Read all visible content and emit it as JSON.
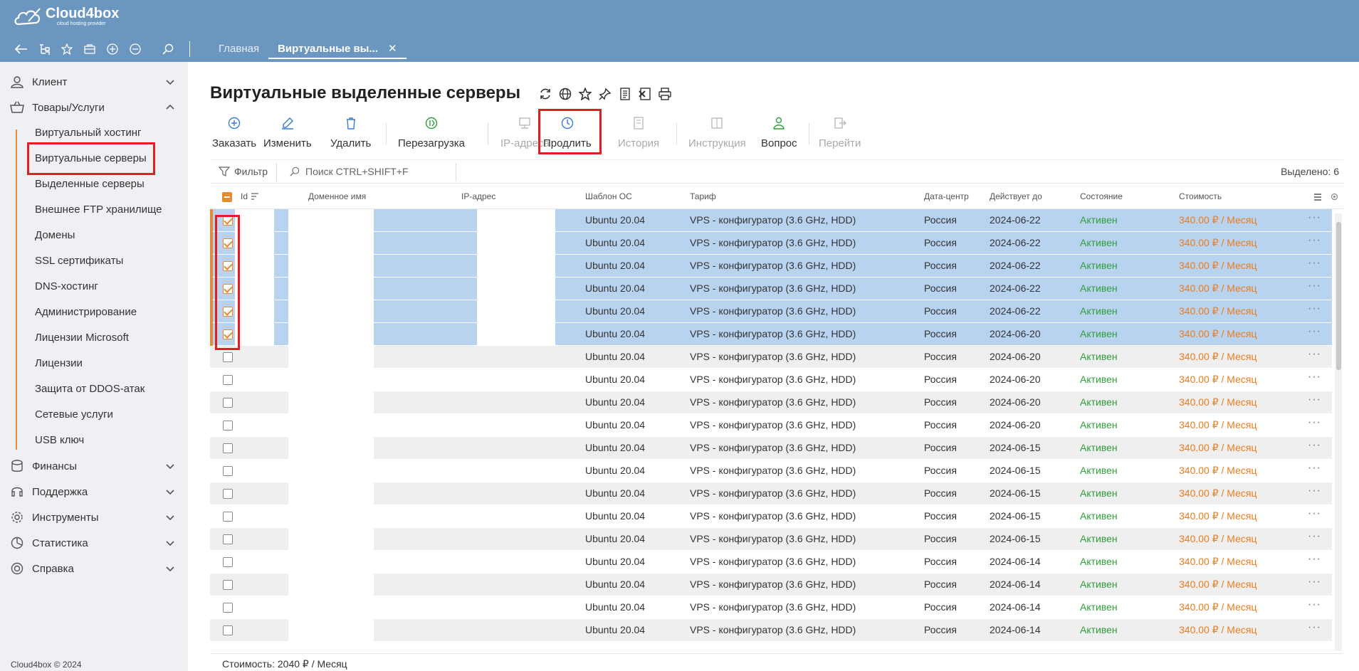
{
  "app": {
    "logo_text": "Cloud4box",
    "logo_sub": "cloud hosting provider",
    "copyright": "Cloud4box © 2024"
  },
  "tabs": [
    {
      "label": "Главная"
    },
    {
      "label": "Виртуальные вы..."
    }
  ],
  "sidebar": {
    "sections": [
      {
        "label": "Клиент"
      },
      {
        "label": "Товары/Услуги"
      },
      {
        "label": "Финансы"
      },
      {
        "label": "Поддержка"
      },
      {
        "label": "Инструменты"
      },
      {
        "label": "Статистика"
      },
      {
        "label": "Справка"
      }
    ],
    "sub_items": [
      {
        "label": "Виртуальный хостинг"
      },
      {
        "label": "Виртуальные серверы"
      },
      {
        "label": "Выделенные серверы"
      },
      {
        "label": "Внешнее FTP хранилище"
      },
      {
        "label": "Домены"
      },
      {
        "label": "SSL сертификаты"
      },
      {
        "label": "DNS-хостинг"
      },
      {
        "label": "Администрирование"
      },
      {
        "label": "Лицензии Microsoft"
      },
      {
        "label": "Лицензии"
      },
      {
        "label": "Защита от DDOS-атак"
      },
      {
        "label": "Сетевые услуги"
      },
      {
        "label": "USB ключ"
      }
    ]
  },
  "page": {
    "title": "Виртуальные выделенные серверы"
  },
  "actions": [
    {
      "label": "Заказать",
      "icon": "plus-circle-icon",
      "enabled": true
    },
    {
      "label": "Изменить",
      "icon": "edit-icon",
      "enabled": true
    },
    {
      "label": "Удалить",
      "icon": "trash-icon",
      "enabled": true
    },
    {
      "label": "Перезагрузка",
      "icon": "reboot-icon",
      "enabled": true
    },
    {
      "label": "IP-адреса",
      "icon": "ip-icon",
      "enabled": false
    },
    {
      "label": "Продлить",
      "icon": "clock-icon",
      "enabled": true
    },
    {
      "label": "История",
      "icon": "history-icon",
      "enabled": false
    },
    {
      "label": "Инструкция",
      "icon": "instruction-icon",
      "enabled": false
    },
    {
      "label": "Вопрос",
      "icon": "question-user-icon",
      "enabled": true
    },
    {
      "label": "Перейти",
      "icon": "goto-icon",
      "enabled": false
    }
  ],
  "filter": {
    "filter_label": "Фильтр",
    "search_placeholder": "Поиск CTRL+SHIFT+F",
    "selected_label": "Выделено: 6"
  },
  "table": {
    "headers": {
      "id": "Id",
      "domain": "Доменное имя",
      "ip": "IP-адрес",
      "os": "Шаблон ОС",
      "tariff": "Тариф",
      "dc": "Дата-центр",
      "valid_until": "Действует до",
      "state": "Состояние",
      "cost": "Стоимость"
    },
    "rows": [
      {
        "checked": true,
        "os": "Ubuntu 20.04",
        "tariff": "VPS - конфигуратор (3.6 GHz, HDD)",
        "dc": "Россия",
        "until": "2024-06-22",
        "state": "Активен",
        "cost": "340.00 ₽ / Месяц"
      },
      {
        "checked": true,
        "os": "Ubuntu 20.04",
        "tariff": "VPS - конфигуратор (3.6 GHz, HDD)",
        "dc": "Россия",
        "until": "2024-06-22",
        "state": "Активен",
        "cost": "340.00 ₽ / Месяц"
      },
      {
        "checked": true,
        "os": "Ubuntu 20.04",
        "tariff": "VPS - конфигуратор (3.6 GHz, HDD)",
        "dc": "Россия",
        "until": "2024-06-22",
        "state": "Активен",
        "cost": "340.00 ₽ / Месяц"
      },
      {
        "checked": true,
        "os": "Ubuntu 20.04",
        "tariff": "VPS - конфигуратор (3.6 GHz, HDD)",
        "dc": "Россия",
        "until": "2024-06-22",
        "state": "Активен",
        "cost": "340.00 ₽ / Месяц"
      },
      {
        "checked": true,
        "os": "Ubuntu 20.04",
        "tariff": "VPS - конфигуратор (3.6 GHz, HDD)",
        "dc": "Россия",
        "until": "2024-06-22",
        "state": "Активен",
        "cost": "340.00 ₽ / Месяц"
      },
      {
        "checked": true,
        "os": "Ubuntu 20.04",
        "tariff": "VPS - конфигуратор (3.6 GHz, HDD)",
        "dc": "Россия",
        "until": "2024-06-20",
        "state": "Активен",
        "cost": "340.00 ₽ / Месяц"
      },
      {
        "checked": false,
        "os": "Ubuntu 20.04",
        "tariff": "VPS - конфигуратор (3.6 GHz, HDD)",
        "dc": "Россия",
        "until": "2024-06-20",
        "state": "Активен",
        "cost": "340.00 ₽ / Месяц"
      },
      {
        "checked": false,
        "os": "Ubuntu 20.04",
        "tariff": "VPS - конфигуратор (3.6 GHz, HDD)",
        "dc": "Россия",
        "until": "2024-06-20",
        "state": "Активен",
        "cost": "340.00 ₽ / Месяц"
      },
      {
        "checked": false,
        "os": "Ubuntu 20.04",
        "tariff": "VPS - конфигуратор (3.6 GHz, HDD)",
        "dc": "Россия",
        "until": "2024-06-20",
        "state": "Активен",
        "cost": "340.00 ₽ / Месяц"
      },
      {
        "checked": false,
        "os": "Ubuntu 20.04",
        "tariff": "VPS - конфигуратор (3.6 GHz, HDD)",
        "dc": "Россия",
        "until": "2024-06-20",
        "state": "Активен",
        "cost": "340.00 ₽ / Месяц"
      },
      {
        "checked": false,
        "os": "Ubuntu 20.04",
        "tariff": "VPS - конфигуратор (3.6 GHz, HDD)",
        "dc": "Россия",
        "until": "2024-06-15",
        "state": "Активен",
        "cost": "340.00 ₽ / Месяц"
      },
      {
        "checked": false,
        "os": "Ubuntu 20.04",
        "tariff": "VPS - конфигуратор (3.6 GHz, HDD)",
        "dc": "Россия",
        "until": "2024-06-15",
        "state": "Активен",
        "cost": "340.00 ₽ / Месяц"
      },
      {
        "checked": false,
        "os": "Ubuntu 20.04",
        "tariff": "VPS - конфигуратор (3.6 GHz, HDD)",
        "dc": "Россия",
        "until": "2024-06-15",
        "state": "Активен",
        "cost": "340.00 ₽ / Месяц"
      },
      {
        "checked": false,
        "os": "Ubuntu 20.04",
        "tariff": "VPS - конфигуратор (3.6 GHz, HDD)",
        "dc": "Россия",
        "until": "2024-06-15",
        "state": "Активен",
        "cost": "340.00 ₽ / Месяц"
      },
      {
        "checked": false,
        "os": "Ubuntu 20.04",
        "tariff": "VPS - конфигуратор (3.6 GHz, HDD)",
        "dc": "Россия",
        "until": "2024-06-15",
        "state": "Активен",
        "cost": "340.00 ₽ / Месяц"
      },
      {
        "checked": false,
        "os": "Ubuntu 20.04",
        "tariff": "VPS - конфигуратор (3.6 GHz, HDD)",
        "dc": "Россия",
        "until": "2024-06-14",
        "state": "Активен",
        "cost": "340.00 ₽ / Месяц"
      },
      {
        "checked": false,
        "os": "Ubuntu 20.04",
        "tariff": "VPS - конфигуратор (3.6 GHz, HDD)",
        "dc": "Россия",
        "until": "2024-06-14",
        "state": "Активен",
        "cost": "340.00 ₽ / Месяц"
      },
      {
        "checked": false,
        "os": "Ubuntu 20.04",
        "tariff": "VPS - конфигуратор (3.6 GHz, HDD)",
        "dc": "Россия",
        "until": "2024-06-14",
        "state": "Активен",
        "cost": "340.00 ₽ / Месяц"
      },
      {
        "checked": false,
        "os": "Ubuntu 20.04",
        "tariff": "VPS - конфигуратор (3.6 GHz, HDD)",
        "dc": "Россия",
        "until": "2024-06-14",
        "state": "Активен",
        "cost": "340.00 ₽ / Месяц"
      }
    ]
  },
  "footer": {
    "total_cost": "Стоимость: 2040 ₽ / Месяц"
  },
  "colors": {
    "header_bg": "#6b96bf",
    "accent_orange": "#e98b2d",
    "selected_row": "#b8d3ef",
    "status_green": "#2f9e3a",
    "highlight_red": "#e01e24"
  }
}
